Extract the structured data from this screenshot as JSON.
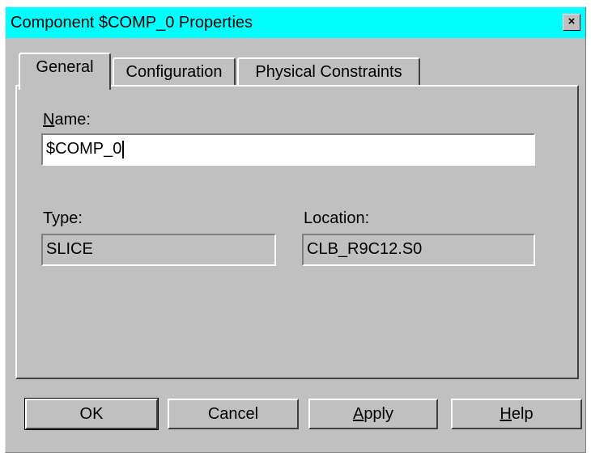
{
  "window": {
    "title": "Component $COMP_0 Properties",
    "close_glyph": "×"
  },
  "tabs": [
    {
      "label": "General",
      "active": true
    },
    {
      "label": "Configuration",
      "active": false
    },
    {
      "label": "Physical Constraints",
      "active": false
    }
  ],
  "general": {
    "name_label_mnemonic": "N",
    "name_label_rest": "ame:",
    "name_value": "$COMP_0",
    "type_label": "Type:",
    "type_value": "SLICE",
    "location_label": "Location:",
    "location_value": "CLB_R9C12.S0"
  },
  "buttons": {
    "ok": "OK",
    "cancel": "Cancel",
    "apply_mnemonic": "A",
    "apply_rest": "pply",
    "help_mnemonic": "H",
    "help_rest": "elp"
  },
  "colors": {
    "titlebar": "#00ffff",
    "face": "#c0c0c0"
  }
}
